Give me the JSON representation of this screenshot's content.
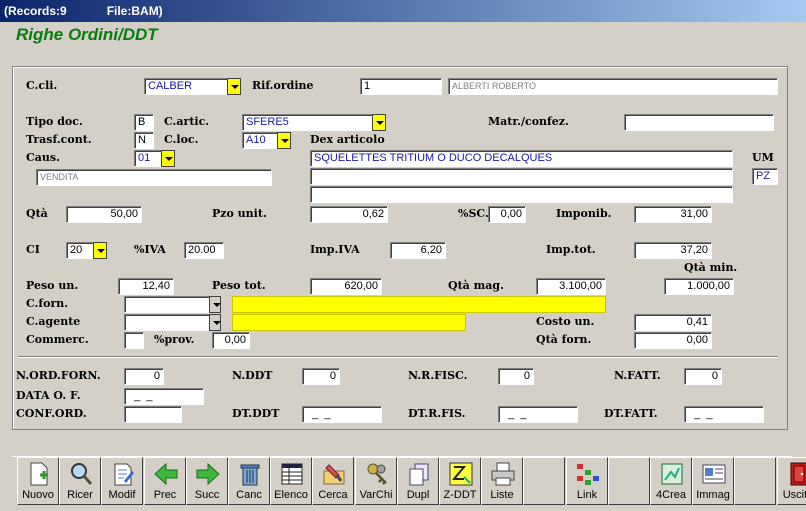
{
  "window": {
    "records": "(Records:9",
    "file": "File:BAM)"
  },
  "form_title": "Righe Ordini/DDT",
  "labels": {
    "ccli": "C.cli.",
    "rif_ordine": "Rif.ordine",
    "tipo_doc": "Tipo doc.",
    "c_artic": "C.artic.",
    "matr_confez": "Matr./confez.",
    "trasf_cont": "Trasf.cont.",
    "c_loc": "C.loc.",
    "dex_articolo": "Dex articolo",
    "caus": "Caus.",
    "um": "UM",
    "qta": "Qtà",
    "pzo_unit": "Pzo unit.",
    "sc": "%SC.",
    "imponib": "Imponib.",
    "ci": "CI",
    "iva": "%IVA",
    "imp_iva": "Imp.IVA",
    "imp_tot": "Imp.tot.",
    "qta_min": "Qtà min.",
    "peso_un": "Peso un.",
    "peso_tot": "Peso tot.",
    "qta_mag": "Qtà mag.",
    "c_forn": "C.forn.",
    "c_agente": "C.agente",
    "costo_un": "Costo un.",
    "commerc": "Commerc.",
    "prov": "%prov.",
    "qta_forn": "Qtà forn.",
    "n_ord_forn": "N.ORD.FORN.",
    "n_ddt": "N.DDT",
    "n_r_fisc": "N.R.FISC.",
    "n_fatt": "N.FATT.",
    "data_o_f": "DATA O. F.",
    "conf_ord": "CONF.ORD.",
    "dt_ddt": "DT.DDT",
    "dt_r_fis": "DT.R.FIS.",
    "dt_fatt": "DT.FATT."
  },
  "values": {
    "ccli": "CALBER",
    "rif_ordine": "1",
    "cliente_nome": "ALBERTI ROBERTO",
    "tipo_doc": "B",
    "c_artic": "SFERE5",
    "matr_confez": "",
    "trasf_cont": "N",
    "c_loc": "A10",
    "caus": "01",
    "caus_desc": "VENDITA",
    "dex1": "SQUELETTES TRITIUM O DUCO DECALQUES",
    "dex2": "",
    "dex3": "",
    "um": "PZ",
    "qta": "50,00",
    "pzo_unit": "0,62",
    "sc": "0,00",
    "imponib": "31,00",
    "ci": "20",
    "iva": "20.00",
    "imp_iva": "6,20",
    "imp_tot": "37,20",
    "peso_un": "12,40",
    "peso_tot": "620,00",
    "qta_mag": "3.100,00",
    "qta_min": "1.000,00",
    "c_forn": "",
    "c_forn_desc": "",
    "c_agente": "",
    "c_agente_desc": "",
    "costo_un": "0,41",
    "commerc": "",
    "prov": "0,00",
    "qta_forn": "0,00",
    "n_ord_forn": "0",
    "n_ddt": "0",
    "n_r_fisc": "0",
    "n_fatt": "0",
    "data_o_f": "  _  _",
    "conf_ord": "",
    "dt_ddt": "  _  _",
    "dt_r_fis": "  _  _",
    "dt_fatt": "  _  _"
  },
  "colors": {
    "title": "#087c10",
    "highlight": "#ffff00"
  },
  "toolbar": [
    {
      "label": "Nuovo",
      "icon": "new-document-icon"
    },
    {
      "label": "Ricer",
      "icon": "magnifier-icon"
    },
    {
      "label": "Modif",
      "icon": "edit-document-icon"
    },
    {
      "label": "Prec",
      "icon": "arrow-left-icon"
    },
    {
      "label": "Succ",
      "icon": "arrow-right-icon"
    },
    {
      "label": "Canc",
      "icon": "trash-icon"
    },
    {
      "label": "Elenco",
      "icon": "list-icon"
    },
    {
      "label": "Cerca",
      "icon": "search-folder-icon"
    },
    {
      "label": "VarChi",
      "icon": "keys-icon"
    },
    {
      "label": "Dupl",
      "icon": "duplicate-icon"
    },
    {
      "label": "Z-DDT",
      "icon": "zddt-icon"
    },
    {
      "label": "Liste",
      "icon": "printer-icon"
    },
    {
      "label": "",
      "icon": ""
    },
    {
      "label": "Link",
      "icon": "link-icon"
    },
    {
      "label": "",
      "icon": ""
    },
    {
      "label": "4Crea",
      "icon": "create-icon"
    },
    {
      "label": "Immag",
      "icon": "image-card-icon"
    },
    {
      "label": "",
      "icon": ""
    },
    {
      "label": "Uscita",
      "icon": "exit-door-icon"
    }
  ]
}
